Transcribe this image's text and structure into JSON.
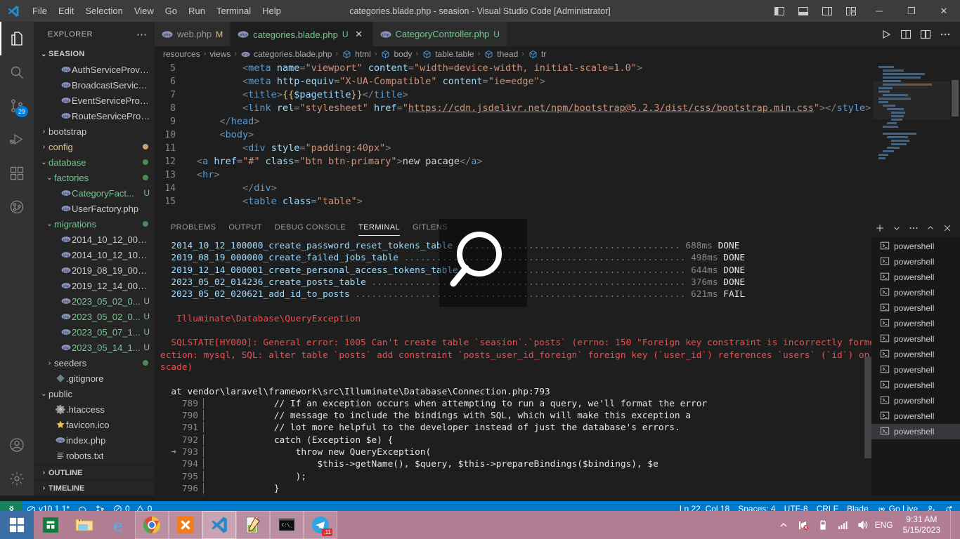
{
  "titlebar": {
    "title": "categories.blade.php - seasion - Visual Studio Code [Administrator]",
    "menu": [
      "File",
      "Edit",
      "Selection",
      "View",
      "Go",
      "Run",
      "Terminal",
      "Help"
    ],
    "window_controls": {
      "minimize": "─",
      "maximize": "❐",
      "close": "✕"
    }
  },
  "activitybar": {
    "source_control_badge": "29",
    "items": [
      "explorer-icon",
      "search-icon",
      "source-control-icon",
      "run-debug-icon",
      "extensions-icon",
      "gitlens-icon",
      "accounts-icon",
      "settings-icon"
    ]
  },
  "sidebar": {
    "header": "EXPLORER",
    "actions": "⋯",
    "root": "SEASION",
    "items": [
      {
        "name": "AuthServiceProvid...",
        "icon": "php-icon",
        "indent": 3,
        "color": "default",
        "twisty": "",
        "status": "",
        "dot": ""
      },
      {
        "name": "BroadcastServicePr...",
        "icon": "php-icon",
        "indent": 3,
        "color": "default",
        "twisty": "",
        "status": "",
        "dot": ""
      },
      {
        "name": "EventServiceProvid...",
        "icon": "php-icon",
        "indent": 3,
        "color": "default",
        "twisty": "",
        "status": "",
        "dot": ""
      },
      {
        "name": "RouteServiceProvi...",
        "icon": "php-icon",
        "indent": 3,
        "color": "default",
        "twisty": "",
        "status": "",
        "dot": ""
      },
      {
        "name": "bootstrap",
        "icon": "",
        "indent": 1,
        "color": "default",
        "twisty": "›",
        "status": "",
        "dot": ""
      },
      {
        "name": "config",
        "icon": "",
        "indent": 1,
        "color": "orange",
        "twisty": "›",
        "status": "",
        "dot": "#c8a070"
      },
      {
        "name": "database",
        "icon": "",
        "indent": 1,
        "color": "green",
        "twisty": "⌄",
        "status": "",
        "dot": "#4e8a56"
      },
      {
        "name": "factories",
        "icon": "",
        "indent": 2,
        "color": "green",
        "twisty": "⌄",
        "status": "",
        "dot": "#4e8a56"
      },
      {
        "name": "CategoryFact...",
        "icon": "php-icon",
        "indent": 3,
        "color": "green",
        "twisty": "",
        "status": "U",
        "dot": ""
      },
      {
        "name": "UserFactory.php",
        "icon": "php-icon",
        "indent": 3,
        "color": "default",
        "twisty": "",
        "status": "",
        "dot": ""
      },
      {
        "name": "migrations",
        "icon": "",
        "indent": 2,
        "color": "green",
        "twisty": "⌄",
        "status": "",
        "dot": "#4e8a56"
      },
      {
        "name": "2014_10_12_00000...",
        "icon": "php-icon",
        "indent": 3,
        "color": "default",
        "twisty": "",
        "status": "",
        "dot": ""
      },
      {
        "name": "2014_10_12_10000...",
        "icon": "php-icon",
        "indent": 3,
        "color": "default",
        "twisty": "",
        "status": "",
        "dot": ""
      },
      {
        "name": "2019_08_19_00000...",
        "icon": "php-icon",
        "indent": 3,
        "color": "default",
        "twisty": "",
        "status": "",
        "dot": ""
      },
      {
        "name": "2019_12_14_00000...",
        "icon": "php-icon",
        "indent": 3,
        "color": "default",
        "twisty": "",
        "status": "",
        "dot": ""
      },
      {
        "name": "2023_05_02_0...",
        "icon": "php-icon",
        "indent": 3,
        "color": "green",
        "twisty": "",
        "status": "U",
        "dot": ""
      },
      {
        "name": "2023_05_02_0...",
        "icon": "php-icon",
        "indent": 3,
        "color": "green",
        "twisty": "",
        "status": "U",
        "dot": ""
      },
      {
        "name": "2023_05_07_1...",
        "icon": "php-icon",
        "indent": 3,
        "color": "green",
        "twisty": "",
        "status": "U",
        "dot": ""
      },
      {
        "name": "2023_05_14_1...",
        "icon": "php-icon",
        "indent": 3,
        "color": "green",
        "twisty": "",
        "status": "U",
        "dot": ""
      },
      {
        "name": "seeders",
        "icon": "",
        "indent": 2,
        "color": "default",
        "twisty": "›",
        "status": "",
        "dot": "#4e8a56"
      },
      {
        "name": ".gitignore",
        "icon": "git-icon",
        "indent": 2,
        "color": "default",
        "twisty": "",
        "status": "",
        "dot": ""
      },
      {
        "name": "public",
        "icon": "",
        "indent": 1,
        "color": "default",
        "twisty": "⌄",
        "status": "",
        "dot": ""
      },
      {
        "name": ".htaccess",
        "icon": "gear-icon",
        "indent": 2,
        "color": "default",
        "twisty": "",
        "status": "",
        "dot": ""
      },
      {
        "name": "favicon.ico",
        "icon": "star-icon",
        "indent": 2,
        "color": "default",
        "twisty": "",
        "status": "",
        "dot": ""
      },
      {
        "name": "index.php",
        "icon": "php-icon",
        "indent": 2,
        "color": "default",
        "twisty": "",
        "status": "",
        "dot": ""
      },
      {
        "name": "robots.txt",
        "icon": "text-icon",
        "indent": 2,
        "color": "default",
        "twisty": "",
        "status": "",
        "dot": ""
      }
    ],
    "footer": [
      "OUTLINE",
      "TIMELINE"
    ]
  },
  "tabs": [
    {
      "label": "web.php",
      "status": "M",
      "active": false,
      "closable": false
    },
    {
      "label": "categories.blade.php",
      "status": "U",
      "active": true,
      "closable": true
    },
    {
      "label": "CategoryController.php",
      "status": "U",
      "active": false,
      "closable": false
    }
  ],
  "tab_actions": [
    "run-icon",
    "split-editor-right-icon",
    "open-changes-icon",
    "more-actions-icon"
  ],
  "breadcrumbs": [
    {
      "label": "resources",
      "icon": ""
    },
    {
      "label": "views",
      "icon": ""
    },
    {
      "label": "categories.blade.php",
      "icon": "php-icon"
    },
    {
      "label": "html",
      "icon": "symbol-icon"
    },
    {
      "label": "body",
      "icon": "symbol-icon"
    },
    {
      "label": "table.table",
      "icon": "symbol-icon"
    },
    {
      "label": "thead",
      "icon": "symbol-icon"
    },
    {
      "label": "tr",
      "icon": "symbol-icon"
    }
  ],
  "code_lines": [
    {
      "num": "5",
      "html": "        <span class=\"t-punc\">&lt;</span><span class=\"t-tag\">meta</span> <span class=\"t-attr\">name</span><span class=\"t-punc\">=</span><span class=\"t-str\">\"viewport\"</span> <span class=\"t-attr\">content</span><span class=\"t-punc\">=</span><span class=\"t-str\">\"width=device-width, initial-scale=1.0\"</span><span class=\"t-punc\">&gt;</span>"
    },
    {
      "num": "6",
      "html": "        <span class=\"t-punc\">&lt;</span><span class=\"t-tag\">meta</span> <span class=\"t-attr\">http-equiv</span><span class=\"t-punc\">=</span><span class=\"t-str\">\"X-UA-Compatible\"</span> <span class=\"t-attr\">content</span><span class=\"t-punc\">=</span><span class=\"t-str\">\"ie=edge\"</span><span class=\"t-punc\">&gt;</span>"
    },
    {
      "num": "7",
      "html": "        <span class=\"t-punc\">&lt;</span><span class=\"t-tag\">title</span><span class=\"t-punc\">&gt;</span><span class=\"t-brace\">{{</span><span class=\"t-var\">$pagetitle</span><span class=\"t-brace\">}}</span><span class=\"t-punc\">&lt;/</span><span class=\"t-tag\">title</span><span class=\"t-punc\">&gt;</span>"
    },
    {
      "num": "8",
      "html": "        <span class=\"t-punc\">&lt;</span><span class=\"t-tag\">link</span> <span class=\"t-attr\">rel</span><span class=\"t-punc\">=</span><span class=\"t-str\">\"stylesheet\"</span> <span class=\"t-attr\">href</span><span class=\"t-punc\">=</span><span class=\"t-str\">\"</span><span class=\"t-link\">https://cdn.jsdelivr.net/npm/bootstrap@5.2.3/dist/css/bootstrap.min.css</span><span class=\"t-str\">\"</span><span class=\"t-punc\">&gt;&lt;/</span><span class=\"t-tag\">style</span><span class=\"t-punc\">&gt;</span>"
    },
    {
      "num": "9",
      "html": "    <span class=\"t-punc\">&lt;/</span><span class=\"t-tag\">head</span><span class=\"t-punc\">&gt;</span>"
    },
    {
      "num": "10",
      "html": "    <span class=\"t-punc\">&lt;</span><span class=\"t-tag\">body</span><span class=\"t-punc\">&gt;</span>"
    },
    {
      "num": "11",
      "html": "        <span class=\"t-punc\">&lt;</span><span class=\"t-tag\">div</span> <span class=\"t-attr\">style</span><span class=\"t-punc\">=</span><span class=\"t-str\">\"padding:40px\"</span><span class=\"t-punc\">&gt;</span>"
    },
    {
      "num": "12",
      "html": "<span class=\"t-punc\">&lt;</span><span class=\"t-tag\">a</span> <span class=\"t-attr\">href</span><span class=\"t-punc\">=</span><span class=\"t-str\">\"#\"</span> <span class=\"t-attr\">class</span><span class=\"t-punc\">=</span><span class=\"t-str\">\"btn btn-primary\"</span><span class=\"t-punc\">&gt;</span><span class=\"t-plain\">new pacage</span><span class=\"t-punc\">&lt;/</span><span class=\"t-tag\">a</span><span class=\"t-punc\">&gt;</span>"
    },
    {
      "num": "13",
      "html": "<span class=\"t-punc\">&lt;</span><span class=\"t-tag\">hr</span><span class=\"t-punc\">&gt;</span>"
    },
    {
      "num": "14",
      "html": "        <span class=\"t-punc\">&lt;/</span><span class=\"t-tag\">div</span><span class=\"t-punc\">&gt;</span>"
    },
    {
      "num": "15",
      "html": "        <span class=\"t-punc\">&lt;</span><span class=\"t-tag\">table</span> <span class=\"t-attr\">class</span><span class=\"t-punc\">=</span><span class=\"t-str\">\"table\"</span><span class=\"t-punc\">&gt;</span>"
    }
  ],
  "panel": {
    "tabs": [
      "PROBLEMS",
      "OUTPUT",
      "DEBUG CONSOLE",
      "TERMINAL",
      "GITLENS"
    ],
    "active_tab": "TERMINAL",
    "actions": [
      "add-terminal-icon",
      "split-dropdown-icon",
      "more-icon",
      "maximize-panel-icon",
      "close-panel-icon"
    ],
    "terminal_lines": [
      "  2014_10_12_100000_create_password_reset_tokens_table ......................................... 688ms DONE",
      "  2019_08_19_000000_create_failed_jobs_table .................................................... 498ms DONE",
      "  2019_12_14_000001_create_personal_access_tokens_table ......................................... 644ms DONE",
      "  2023_05_02_014236_create_posts_table .......................................................... 376ms DONE",
      "  2023_05_02_020621_add_id_to_posts ............................................................. 621ms FAIL",
      "",
      "   Illuminate\\Database\\QueryException",
      "",
      "  SQLSTATE[HY000]: General error: 1005 Can't create table `seasion`.`posts` (errno: 150 \"Foreign key constraint is incorrectly formed\") (Conn",
      "ection: mysql, SQL: alter table `posts` add constraint `posts_user_id_foreign` foreign key (`user_id`) references `users` (`id`) on delete ca",
      "scade)",
      "",
      "  at vendor\\laravel\\framework\\src\\Illuminate\\Database\\Connection.php:793",
      "    789▕             // If an exception occurs when attempting to run a query, we'll format the error",
      "    790▕             // message to include the bindings with SQL, which will make this exception a",
      "    791▕             // lot more helpful to the developer instead of just the database's errors.",
      "    792▕             catch (Exception $e) {",
      "  ➜ 793▕                 throw new QueryException(",
      "    794▕                     $this->getName(), $query, $this->prepareBindings($bindings), $e",
      "    795▕                 );",
      "    796▕             }",
      "    797▕         }"
    ],
    "terminal_list": [
      "powershell",
      "powershell",
      "powershell",
      "powershell",
      "powershell",
      "powershell",
      "powershell",
      "powershell",
      "powershell",
      "powershell",
      "powershell",
      "powershell",
      "powershell"
    ],
    "terminal_list_selected_index": 12
  },
  "statusbar": {
    "remote_icon": "remote-window-icon",
    "left": [
      {
        "icon": "gitlens-icon",
        "label": "v10.1.1*"
      },
      {
        "icon": "cloud-icon",
        "label": ""
      },
      {
        "icon": "branch-compare-icon",
        "label": ""
      },
      {
        "icon": "error-icon",
        "label": "0"
      },
      {
        "icon": "warning-icon",
        "label": "0"
      }
    ],
    "right": [
      {
        "icon": "",
        "label": "Ln 22, Col 18"
      },
      {
        "icon": "",
        "label": "Spaces: 4"
      },
      {
        "icon": "",
        "label": "UTF-8"
      },
      {
        "icon": "",
        "label": "CRLF"
      },
      {
        "icon": "",
        "label": "Blade"
      },
      {
        "icon": "broadcast-icon",
        "label": "Go Live"
      },
      {
        "icon": "feedback-icon",
        "label": ""
      },
      {
        "icon": "bell-dot-icon",
        "label": ""
      }
    ]
  },
  "taskbar": {
    "start": "windows-start-icon",
    "items": [
      {
        "icon": "microsoft-store-icon",
        "state": "pinned"
      },
      {
        "icon": "file-explorer-icon",
        "state": "pinned"
      },
      {
        "icon": "internet-explorer-icon",
        "state": "pinned"
      },
      {
        "icon": "google-chrome-icon",
        "state": "running"
      },
      {
        "icon": "xampp-icon",
        "state": "running"
      },
      {
        "icon": "vscode-icon",
        "state": "active"
      },
      {
        "icon": "notepadpp-icon",
        "state": "running"
      },
      {
        "icon": "command-prompt-icon",
        "state": "running"
      },
      {
        "icon": "telegram-icon",
        "state": "running",
        "badge": ".11"
      }
    ],
    "tray": {
      "show_hidden": "chevron-up-icon",
      "icons": [
        "network-error-icon",
        "battery-icon",
        "signal-icon",
        "volume-icon"
      ],
      "language": "ENG",
      "time": "9:31 AM",
      "date": "5/15/2023"
    }
  }
}
